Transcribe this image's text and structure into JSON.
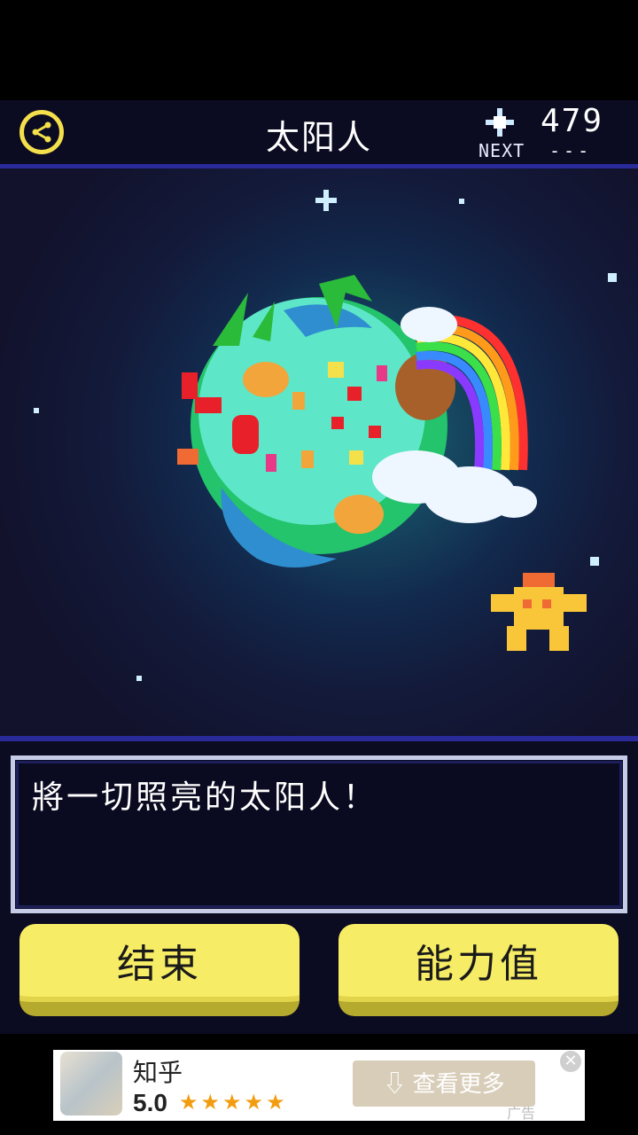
{
  "header": {
    "title": "太阳人",
    "next_label": "NEXT",
    "count": "479",
    "count_sub": "---"
  },
  "dialog": {
    "text": "將一切照亮的太阳人！"
  },
  "buttons": {
    "end_label": "结束",
    "ability_label": "能力值"
  },
  "ad": {
    "name": "知乎",
    "rating": "5.0",
    "stars": "★★★★★",
    "cta": "⇩ 查看更多",
    "close": "✕",
    "tag": "广告"
  },
  "colors": {
    "accent_yellow": "#f7ec66",
    "header_bg": "#0b0b22",
    "divider": "#2a2a9a"
  },
  "icons": [
    "share-icon",
    "star-icon",
    "planet",
    "sun-man-character"
  ]
}
